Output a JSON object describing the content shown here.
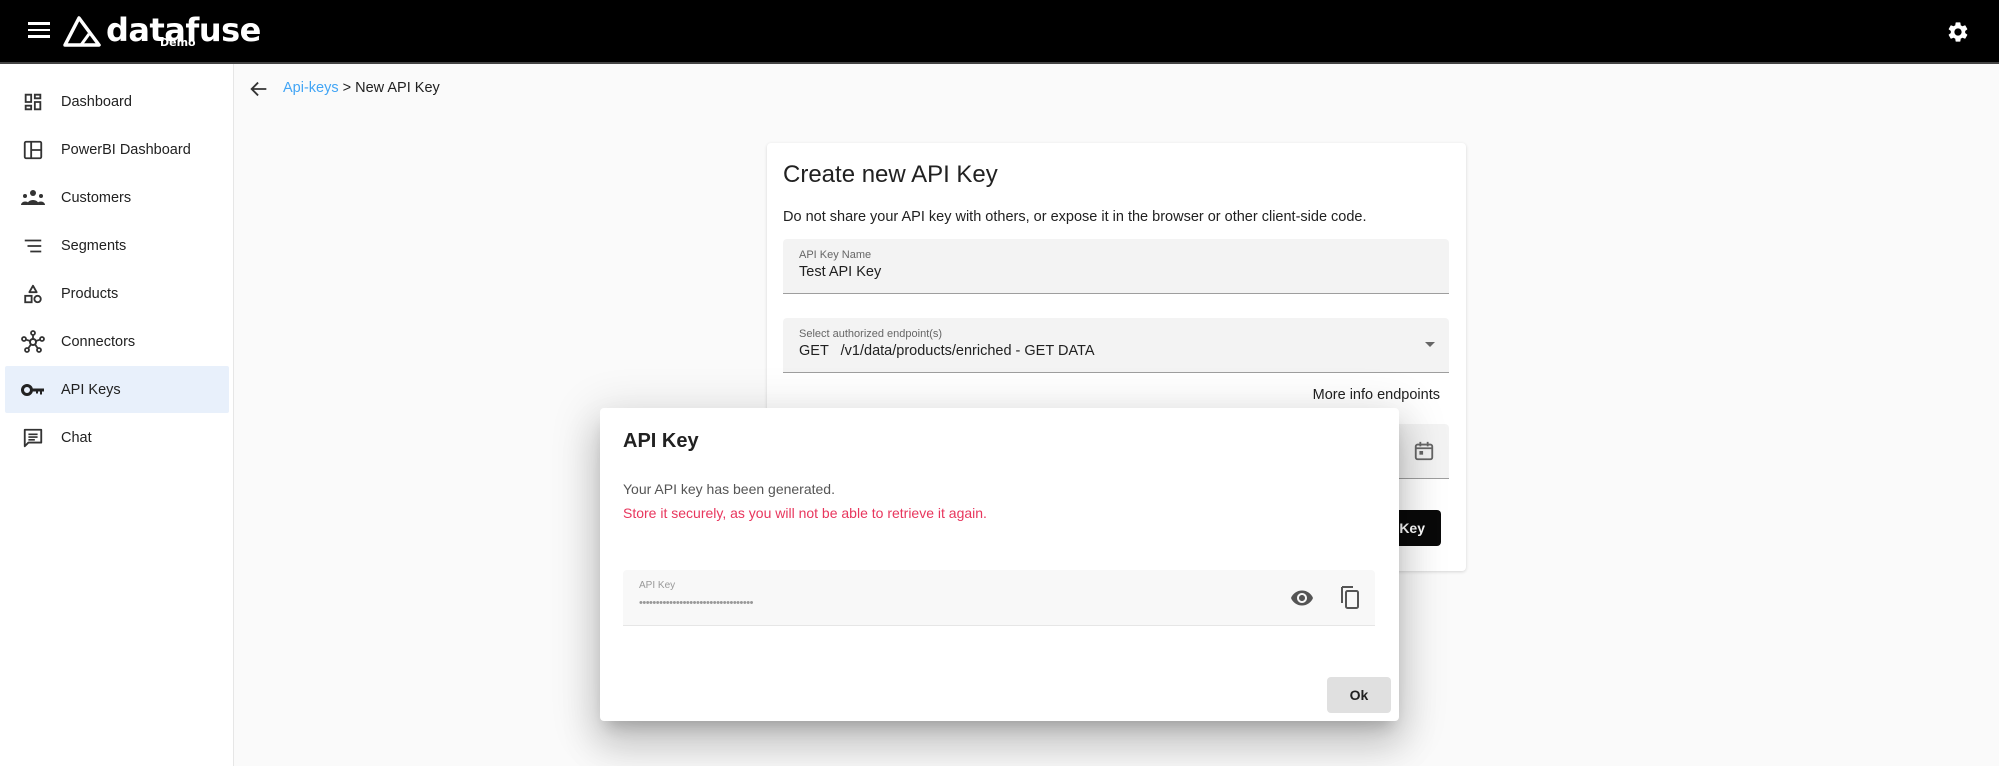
{
  "header": {
    "brand": "datafuse",
    "brand_sub": "Demo",
    "menu_icon": "hamburger-menu-icon",
    "settings_icon": "gear-icon"
  },
  "sidebar": {
    "items": [
      {
        "label": "Dashboard",
        "icon": "dashboard-icon",
        "active": false
      },
      {
        "label": "PowerBI Dashboard",
        "icon": "layout-panel-icon",
        "active": false
      },
      {
        "label": "Customers",
        "icon": "groups-icon",
        "active": false
      },
      {
        "label": "Segments",
        "icon": "segments-list-icon",
        "active": false
      },
      {
        "label": "Products",
        "icon": "category-shapes-icon",
        "active": false
      },
      {
        "label": "Connectors",
        "icon": "hub-icon",
        "active": false
      },
      {
        "label": "API Keys",
        "icon": "key-icon",
        "active": true
      },
      {
        "label": "Chat",
        "icon": "chat-icon",
        "active": false
      }
    ]
  },
  "breadcrumb": {
    "parent": "Api-keys",
    "separator": " > ",
    "current": "New API Key"
  },
  "form": {
    "title": "Create new API Key",
    "description": "Do not share your API key with others, or expose it in the browser or other client-side code.",
    "name_label": "API Key Name",
    "name_value": "Test API Key",
    "endpoint_label": "Select authorized endpoint(s)",
    "endpoint_value": "GET   /v1/data/products/enriched - GET DATA",
    "more_info": "More info endpoints",
    "generate_label": "Key"
  },
  "dialog": {
    "title": "API Key",
    "message": "Your API key has been generated.",
    "warning": "Store it securely, as you will not be able to retrieve it again.",
    "key_label": "API Key",
    "key_value": "••••••••••••••••••••••••••••••••••",
    "ok_label": "Ok",
    "warning_color": "#e8365d"
  }
}
